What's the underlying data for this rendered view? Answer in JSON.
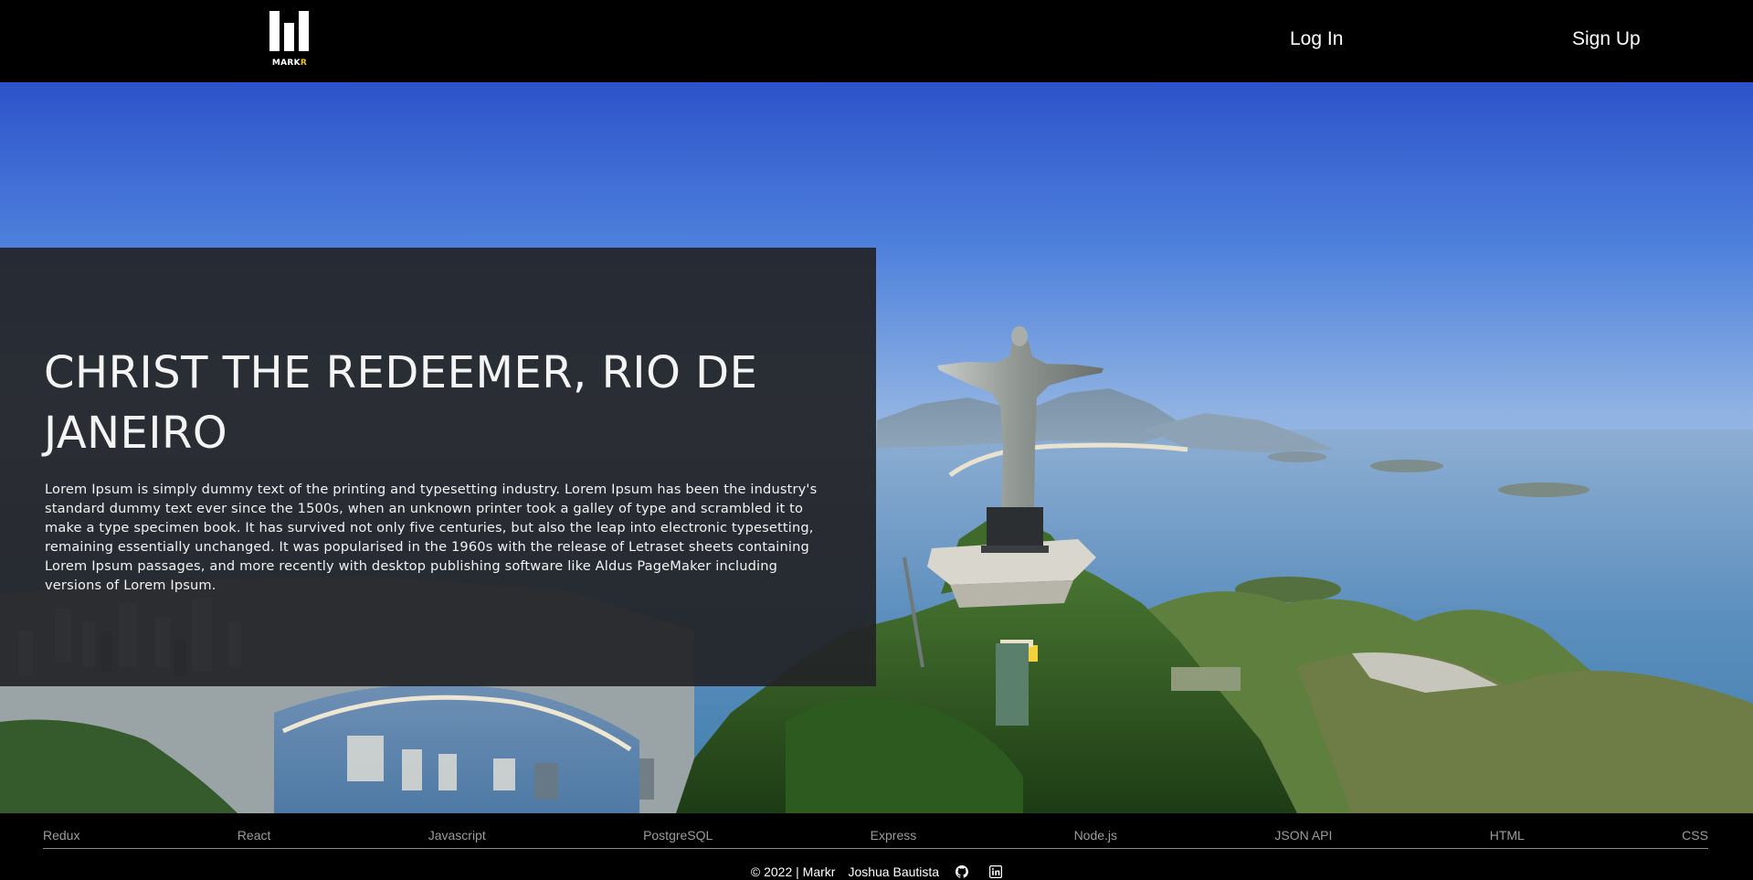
{
  "brand": {
    "logo_text": "MARK",
    "logo_accent": "R",
    "accent_color": "#f0c419"
  },
  "nav": {
    "login_label": "Log In",
    "signup_label": "Sign Up"
  },
  "hero": {
    "image_alt": "Christ the Redeemer statue overlooking Rio de Janeiro",
    "title": "CHRIST THE REDEEMER, RIO DE JANEIRO",
    "description": "Lorem Ipsum is simply dummy text of the printing and typesetting industry. Lorem Ipsum has been the industry's standard dummy text ever since the 1500s, when an unknown printer took a galley of type and scrambled it to make a type specimen book. It has survived not only five centuries, but also the leap into electronic typesetting, remaining essentially unchanged. It was popularised in the 1960s with the release of Letraset sheets containing Lorem Ipsum passages, and more recently with desktop publishing software like Aldus PageMaker including versions of Lorem Ipsum."
  },
  "footer": {
    "technologies": [
      "Redux",
      "React",
      "Javascript",
      "PostgreSQL",
      "Express",
      "Node.js",
      "JSON API",
      "HTML",
      "CSS"
    ],
    "copyright": "© 2022 | Markr",
    "author": "Joshua Bautista",
    "social_icons": [
      "github-icon",
      "linkedin-icon"
    ]
  }
}
